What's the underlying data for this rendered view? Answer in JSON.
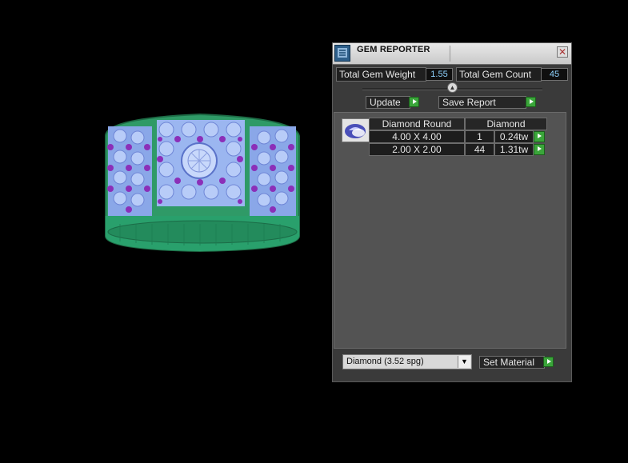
{
  "panel": {
    "title": "GEM REPORTER",
    "close_glyph": "✕",
    "total_weight_label": "Total Gem Weight",
    "total_weight_value": "1.55",
    "total_count_label": "Total Gem Count",
    "total_count_value": "45",
    "update_label": "Update",
    "save_label": "Save Report",
    "table": {
      "headers": [
        "Diamond Round",
        "Diamond"
      ],
      "rows": [
        {
          "size": "4.00 X 4.00",
          "count": "1",
          "weight": "0.24tw"
        },
        {
          "size": "2.00 X 2.00",
          "count": "44",
          "weight": "1.31tw"
        }
      ]
    },
    "material_select": "Diamond     (3.52 spg)",
    "set_material_label": "Set Material"
  },
  "icons": {
    "app": "gem-reporter-app-icon",
    "thumb": "round-diamond-icon",
    "action": "green-play-arrow-icon"
  }
}
